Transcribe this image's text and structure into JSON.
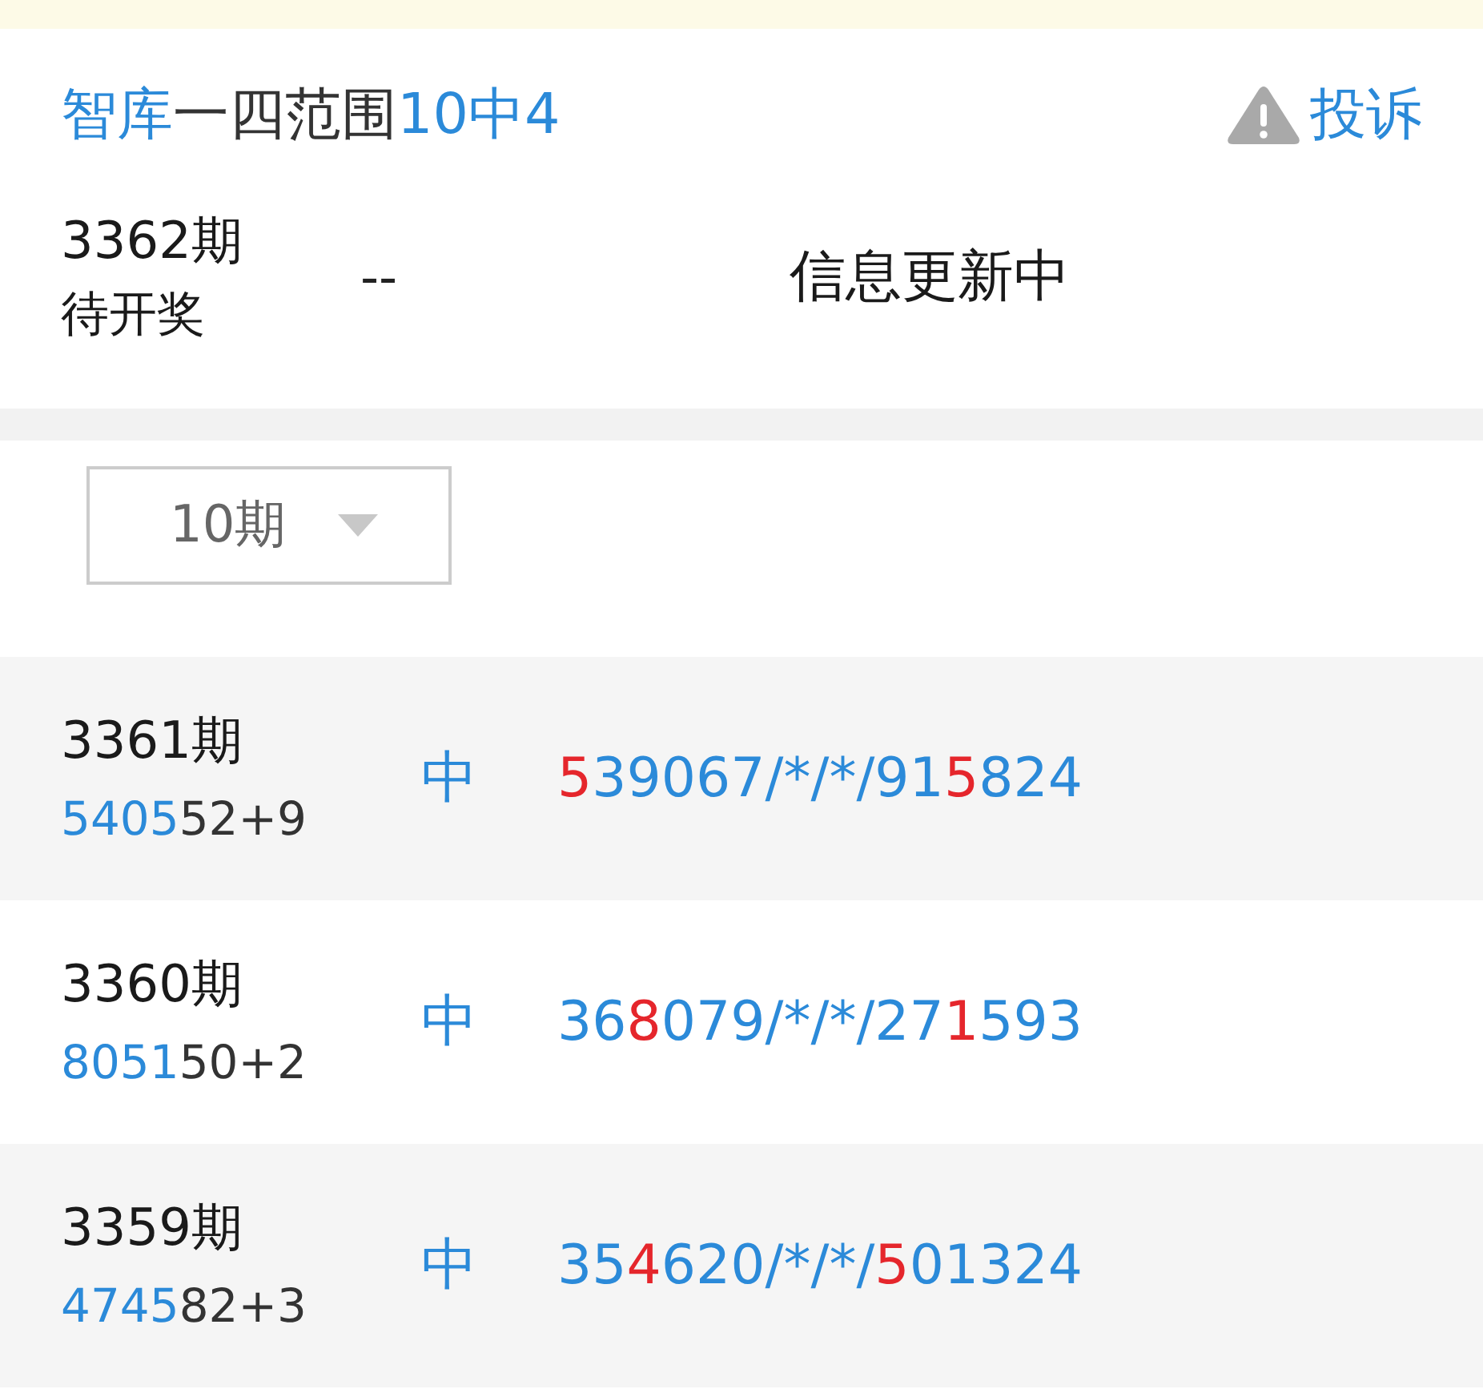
{
  "header": {
    "title": [
      {
        "text": "智库",
        "highlight": true
      },
      {
        "text": "一四范围",
        "highlight": false
      },
      {
        "text": "10中4",
        "highlight": true
      }
    ],
    "complaint_button": {
      "label": "投诉"
    }
  },
  "current_draw": {
    "period": "3362期",
    "status": "待开奖",
    "result": "--",
    "message": "信息更新中"
  },
  "period_filter": {
    "value": "10期"
  },
  "history": [
    {
      "period": "3361期",
      "code": [
        {
          "text": "5405",
          "highlight": true
        },
        {
          "text": "52+9",
          "highlight": false
        }
      ],
      "verdict": "中",
      "prediction": [
        {
          "text": "5",
          "hit": true
        },
        {
          "text": "39067/*/*/91",
          "hit": false
        },
        {
          "text": "5",
          "hit": true
        },
        {
          "text": "824",
          "hit": false
        }
      ]
    },
    {
      "period": "3360期",
      "code": [
        {
          "text": "8051",
          "highlight": true
        },
        {
          "text": "50+2",
          "highlight": false
        }
      ],
      "verdict": "中",
      "prediction": [
        {
          "text": "36",
          "hit": false
        },
        {
          "text": "8",
          "hit": true
        },
        {
          "text": "079/*/*/27",
          "hit": false
        },
        {
          "text": "1",
          "hit": true
        },
        {
          "text": "593",
          "hit": false
        }
      ]
    },
    {
      "period": "3359期",
      "code": [
        {
          "text": "4745",
          "highlight": true
        },
        {
          "text": "82+3",
          "highlight": false
        }
      ],
      "verdict": "中",
      "prediction": [
        {
          "text": "35",
          "hit": false
        },
        {
          "text": "4",
          "hit": true
        },
        {
          "text": "620/*/*/",
          "hit": false
        },
        {
          "text": "5",
          "hit": true
        },
        {
          "text": "01324",
          "hit": false
        }
      ]
    }
  ]
}
